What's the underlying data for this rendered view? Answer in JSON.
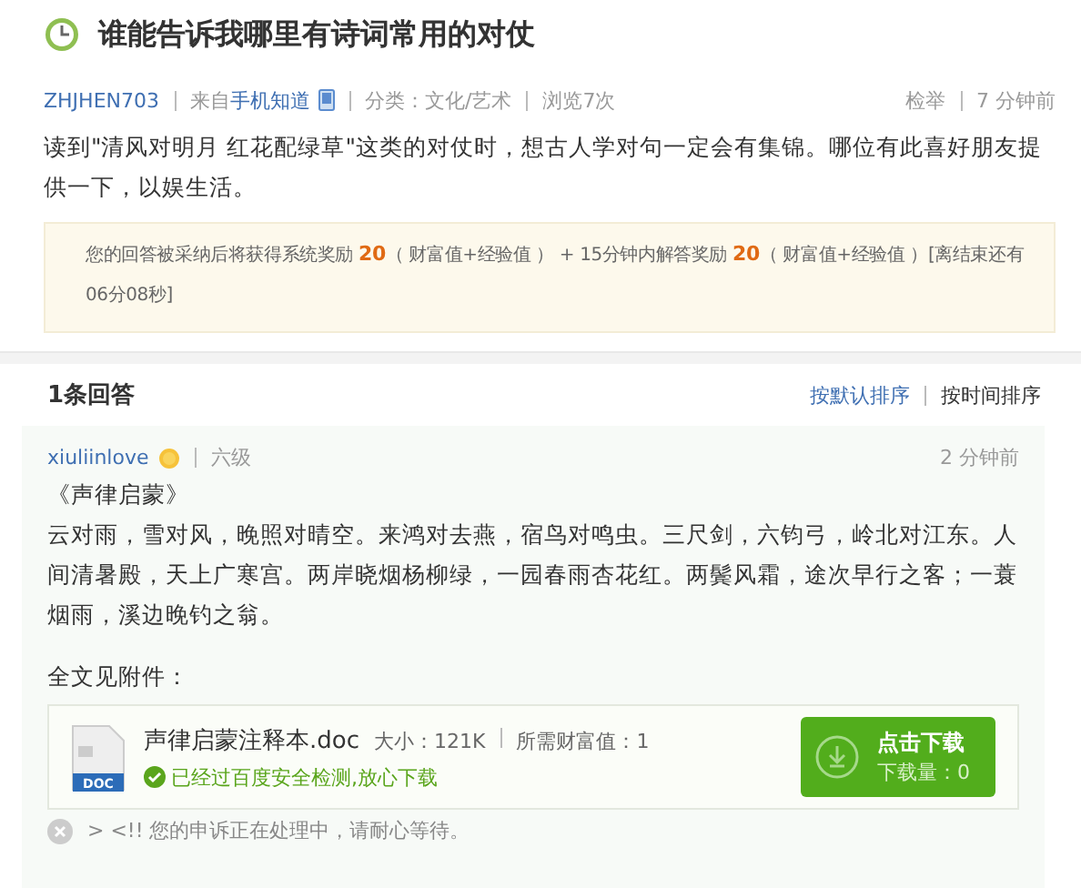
{
  "question": {
    "title": "谁能告诉我哪里有诗词常用的对仗",
    "author": "ZHJHEN703",
    "source_prefix": "来自",
    "source": "手机知道",
    "category": "分类：文化/艺术",
    "views": "浏览7次",
    "report": "检举",
    "time": "7 分钟前",
    "body": "读到\"清风对明月 红花配绿草\"这类的对仗时，想古人学对句一定会有集锦。哪位有此喜好朋友提供一下，以娱生活。"
  },
  "notice": {
    "text": "您的回答被采纳后将获得系统奖励 **20**（ 财富值+经验值 ） + 15分钟内解答奖励 **20**（ 财富值+经验值 ）[离结束还有06分08秒]"
  },
  "answers_header": {
    "count": "1条回答",
    "sort_options": [
      {
        "label": "按默认排序",
        "selected": false
      },
      {
        "label": "按时间排序",
        "selected": true
      }
    ]
  },
  "answer": {
    "user": "xiuliinlove",
    "level": "六级",
    "time": "2 分钟前",
    "book_title": "《声律启蒙》",
    "text": "云对雨，雪对风，晚照对晴空。来鸿对去燕，宿鸟对鸣虫。三尺剑，六钧弓，岭北对江东。人间清暑殿，天上广寒宫。两岸晓烟杨柳绿，一园春雨杏花红。两鬓风霜，途次早行之客；一蓑烟雨，溪边晚钓之翁。",
    "attachment_label": "全文见附件：",
    "attachment": {
      "file_type": "DOC",
      "file_name": "声律启蒙注释本.doc",
      "size": "大小：121K",
      "cost": "所需财富值：1",
      "security": "已经过百度安全检测,放心下载",
      "download_label": "点击下载",
      "download_count": "下载量：0"
    }
  },
  "footer": {
    "text": "> <!! 您的申诉正在处理中，请耐心等待。"
  }
}
